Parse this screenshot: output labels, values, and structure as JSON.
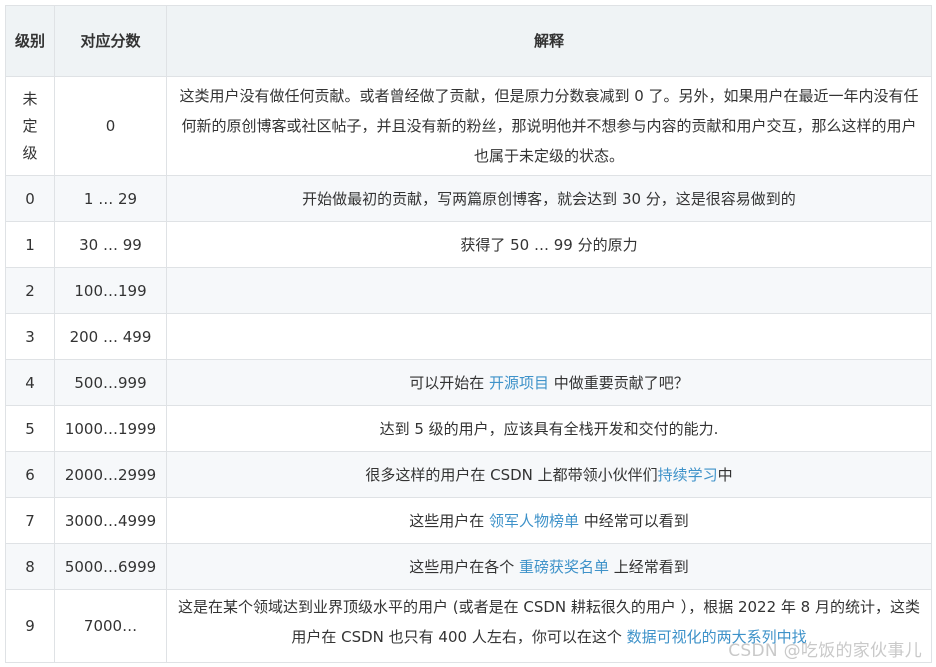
{
  "header": {
    "level": "级别",
    "score": "对应分数",
    "explanation": "解释"
  },
  "rows": [
    {
      "level": "未定级",
      "score": "0",
      "text": "这类用户没有做任何贡献。或者曾经做了贡献，但是原力分数衰减到 0 了。另外，如果用户在最近一年内没有任何新的原创博客或社区帖子，并且没有新的粉丝，那说明他并不想参与内容的贡献和用户交互，那么这样的用户也属于未定级的状态。"
    },
    {
      "level": "0",
      "score": "1 … 29",
      "text": "开始做最初的贡献，写两篇原创博客，就会达到 30 分，这是很容易做到的"
    },
    {
      "level": "1",
      "score": "30 … 99",
      "text": "获得了 50 … 99 分的原力"
    },
    {
      "level": "2",
      "score": "100…199",
      "text": ""
    },
    {
      "level": "3",
      "score": "200 … 499",
      "text": ""
    },
    {
      "level": "4",
      "score": "500…999",
      "text_before": "可以开始在 ",
      "link": "开源项目",
      "text_after": " 中做重要贡献了吧？"
    },
    {
      "level": "5",
      "score": "1000…1999",
      "text": "达到 5 级的用户，应该具有全栈开发和交付的能力."
    },
    {
      "level": "6",
      "score": "2000…2999",
      "text_before": "很多这样的用户在 CSDN 上都带领小伙伴们",
      "link": "持续学习",
      "text_after": "中"
    },
    {
      "level": "7",
      "score": "3000…4999",
      "text_before": "这些用户在 ",
      "link": "领军人物榜单",
      "text_after": " 中经常可以看到"
    },
    {
      "level": "8",
      "score": "5000…6999",
      "text_before": "这些用户在各个 ",
      "link": "重磅获奖名单",
      "text_after": " 上经常看到"
    },
    {
      "level": "9",
      "score": "7000…",
      "text_before": "这是在某个领域达到业界顶级水平的用户 (或者是在 CSDN 耕耘很久的用户 ），根据 2022 年 8 月的统计，这类用户在 CSDN 也只有 400 人左右，你可以在这个 ",
      "link": "数据可视化的两大系列中找",
      "text_after": ""
    }
  ],
  "watermark": "CSDN @吃饭的家伙事儿",
  "colors": {
    "header_bg": "#eff3f5",
    "stripe_bg": "#f6f8fa",
    "border": "#dfe2e5",
    "text": "#333333",
    "link": "#3e92c9"
  }
}
